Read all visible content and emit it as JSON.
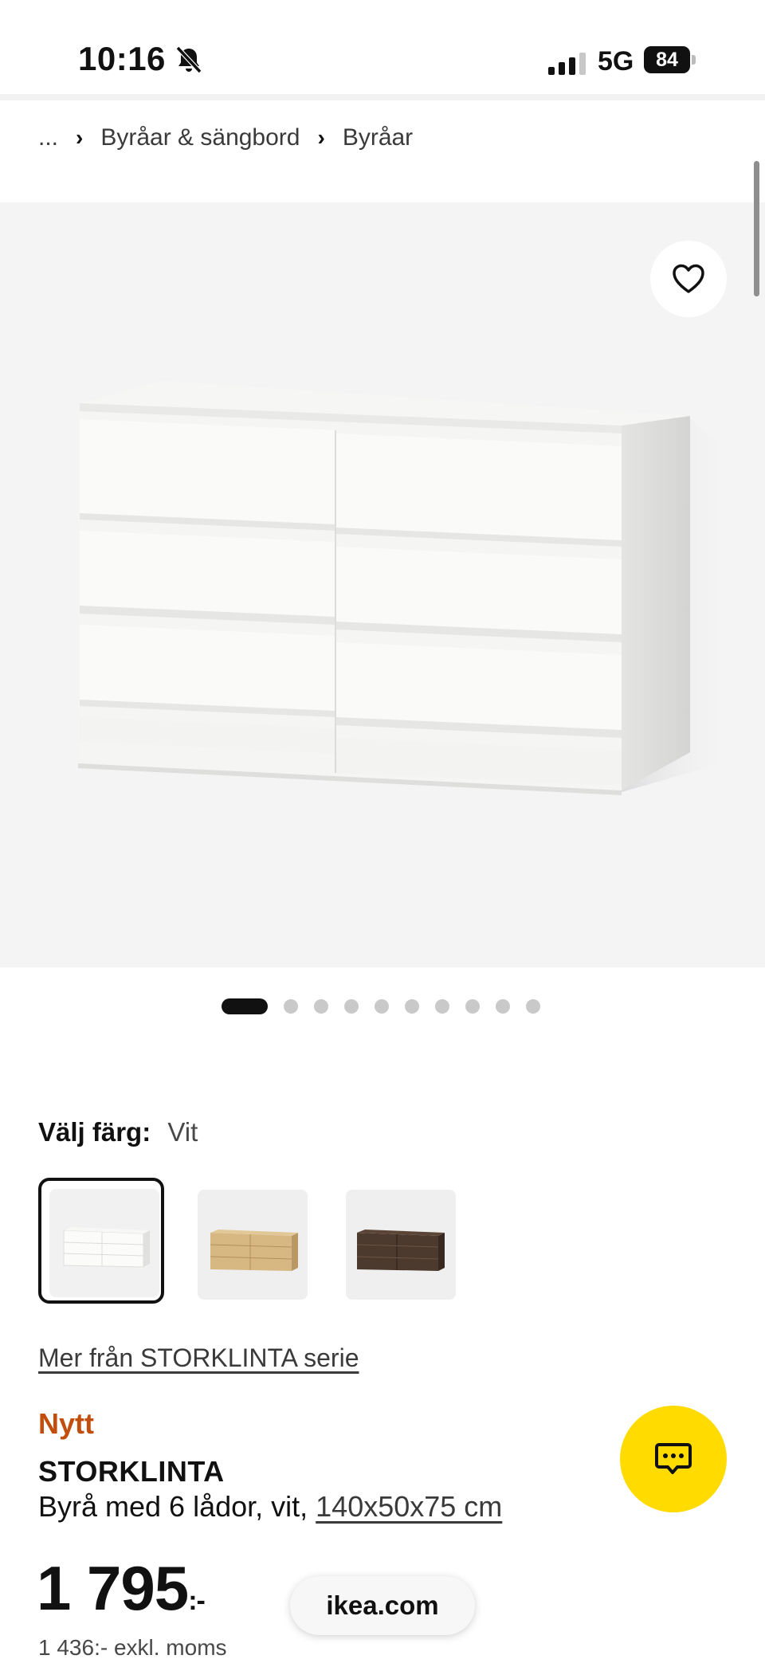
{
  "status_bar": {
    "time": "10:16",
    "network": "5G",
    "battery": "84"
  },
  "breadcrumb": {
    "items": [
      "...",
      "Byråar & sängbord",
      "Byråar"
    ]
  },
  "carousel": {
    "total_images": 10,
    "active_index": 0
  },
  "color_selector": {
    "label": "Välj färg:",
    "selected": "Vit",
    "swatches": [
      {
        "name": "vit",
        "color": "#f2f2f0"
      },
      {
        "name": "ekmönstrad",
        "color": "#d9b985"
      },
      {
        "name": "brun",
        "color": "#4b3a2f"
      }
    ]
  },
  "series_link": "Mer från STORKLINTA serie",
  "product": {
    "badge": "Nytt",
    "name": "STORKLINTA",
    "description": "Byrå med 6 lådor, vit, ",
    "dimensions": "140x50x75 cm",
    "price": "1 795",
    "price_suffix": ":-",
    "price_excl_vat": "1 436:- exkl. moms"
  },
  "browser": {
    "url": "ikea.com"
  },
  "colors": {
    "badge_new": "#c24e0e",
    "chat_button": "#ffdb00",
    "image_bg": "#f4f4f5"
  }
}
